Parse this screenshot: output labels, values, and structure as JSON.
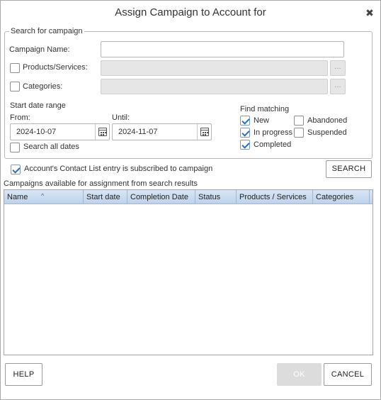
{
  "dialog": {
    "title": "Assign Campaign to Account for",
    "close_glyph": "✖"
  },
  "search": {
    "legend": "Search for campaign",
    "campaign_name_label": "Campaign Name:",
    "campaign_name_value": "",
    "products_label": "Products/Services:",
    "products_checked": false,
    "categories_label": "Categories:",
    "categories_checked": false,
    "ellipsis": "...",
    "date_range_title": "Start date range",
    "from_label": "From:",
    "from_value": "2024-10-07",
    "until_label": "Until:",
    "until_value": "2024-11-07",
    "search_all_label": "Search all dates",
    "search_all_checked": false,
    "find_matching_title": "Find matching",
    "statuses": [
      {
        "label": "New",
        "checked": true
      },
      {
        "label": "In progress",
        "checked": true
      },
      {
        "label": "Completed",
        "checked": true
      },
      {
        "label": "Abandoned",
        "checked": false
      },
      {
        "label": "Suspended",
        "checked": false
      }
    ]
  },
  "subscribed": {
    "label": "Account's Contact List entry is subscribed to campaign",
    "checked": true
  },
  "search_button": "SEARCH",
  "results": {
    "caption": "Campaigns available for assignment from search results",
    "columns": [
      "Name",
      "Start date",
      "Completion Date",
      "Status",
      "Products / Services",
      "Categories"
    ],
    "rows": []
  },
  "footer": {
    "help": "HELP",
    "ok": "OK",
    "cancel": "CANCEL"
  },
  "icons": [
    "close-icon",
    "ellipsis-icon",
    "calendar-icon",
    "checkmark-icon",
    "sort-ascending-icon"
  ],
  "colors": {
    "accent": "#2a6fba",
    "header_gradient_top": "#d9e6f5",
    "header_gradient_bottom": "#bdd2eb",
    "disabled": "#e6e6e6"
  }
}
